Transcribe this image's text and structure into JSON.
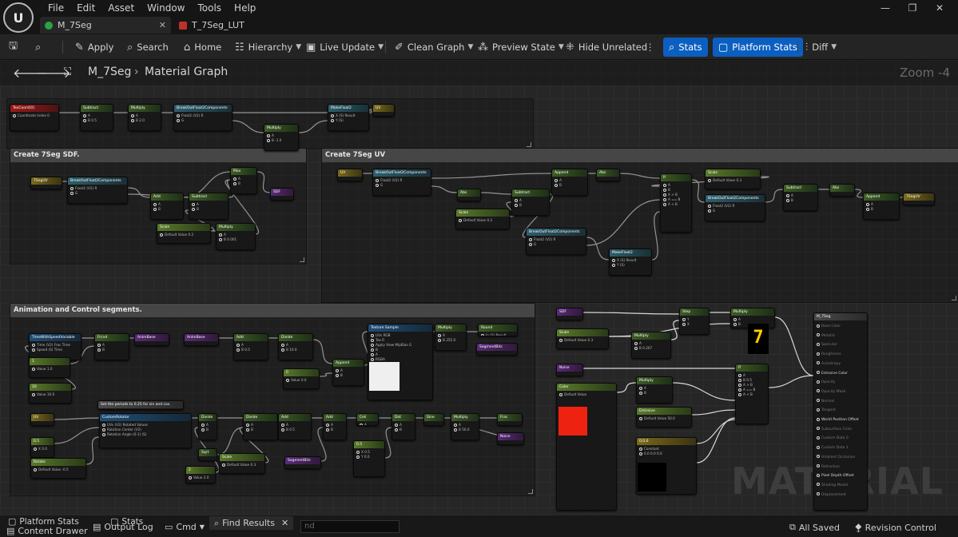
{
  "app": {
    "logo": "U"
  },
  "menu": [
    "File",
    "Edit",
    "Asset",
    "Window",
    "Tools",
    "Help"
  ],
  "window_controls": [
    "—",
    "❐",
    "✕"
  ],
  "tabs": [
    {
      "label": "M_7Seg",
      "active": true,
      "close": "✕",
      "color": "#2aa344"
    },
    {
      "label": "T_7Seg_LUT",
      "active": false,
      "color": "#c0302a"
    }
  ],
  "toolbar": {
    "apply": "Apply",
    "search": "Search",
    "home": "Home",
    "hierarchy": "Hierarchy",
    "live_update": "Live Update",
    "clean_graph": "Clean Graph",
    "preview_state": "Preview State",
    "hide_unrelated": "Hide Unrelated",
    "stats": "Stats",
    "platform_stats": "Platform Stats",
    "diff": "Diff"
  },
  "graph": {
    "breadcrumb": [
      "M_7Seg",
      "Material Graph"
    ],
    "zoom": "Zoom -4",
    "watermark": "MATERIAL"
  },
  "comments": [
    {
      "title": ""
    },
    {
      "title": "Create 7Seg SDF."
    },
    {
      "title": "Create 7Seg UV"
    },
    {
      "title": "Animation and Control segments."
    }
  ],
  "nodes": [
    {
      "title": "TexCoord[0]",
      "color": "red",
      "rows": [
        "Coordinate Index 0"
      ]
    },
    {
      "title": "Subtract",
      "color": "gr",
      "rows": [
        "A",
        "B 0.5"
      ]
    },
    {
      "title": "Multiply",
      "color": "gr",
      "rows": [
        "A",
        "B 2.0"
      ]
    },
    {
      "title": "BreakOutFloat2Components",
      "color": "tl",
      "rows": [
        "Float2 (V2)   R",
        "G"
      ]
    },
    {
      "title": "Multiply",
      "color": "gr",
      "rows": [
        "A",
        "B -1.0"
      ]
    },
    {
      "title": "MakeFloat2",
      "color": "tl",
      "rows": [
        "X (S)  Result",
        "Y (S)"
      ]
    },
    {
      "title": "UV",
      "color": "ol",
      "rows": []
    },
    {
      "title": "7SegUV",
      "color": "ol",
      "rows": []
    },
    {
      "title": "BreakOutFloat2Components",
      "color": "tl",
      "rows": [
        "Float2 (V2)  R",
        "G"
      ]
    },
    {
      "title": "Add",
      "color": "gr",
      "rows": [
        "A",
        "B"
      ]
    },
    {
      "title": "Subtract",
      "color": "gr",
      "rows": [
        "A",
        "B"
      ]
    },
    {
      "title": "Max",
      "color": "gr",
      "rows": [
        "A",
        "B"
      ]
    },
    {
      "title": "SDF",
      "color": "pu",
      "rows": []
    },
    {
      "title": "Scale",
      "color": "gr2",
      "rows": [
        "Default Value 0.2"
      ]
    },
    {
      "title": "Multiply",
      "color": "gr",
      "rows": [
        "A",
        "B 0.001"
      ]
    },
    {
      "title": "UV",
      "color": "ol",
      "rows": []
    },
    {
      "title": "BreakOutFloat2Components",
      "color": "tl",
      "rows": [
        "Float2 (V2)  R",
        "G"
      ]
    },
    {
      "title": "Append",
      "color": "gr",
      "rows": [
        "A",
        "B"
      ]
    },
    {
      "title": "Abs",
      "color": "gr",
      "rows": []
    },
    {
      "title": "Abs",
      "color": "gr",
      "rows": []
    },
    {
      "title": "Subtract",
      "color": "gr",
      "rows": [
        "A",
        "B"
      ]
    },
    {
      "title": "Scale",
      "color": "gr2",
      "rows": [
        "Default Value 0.2"
      ]
    },
    {
      "title": "BreakOutFloat2Components",
      "color": "tl",
      "rows": [
        "Float2 (V2)  R",
        "G"
      ]
    },
    {
      "title": "MakeFloat2",
      "color": "tl",
      "rows": [
        "X (S)  Result",
        "Y (S)"
      ]
    },
    {
      "title": "If",
      "color": "gr",
      "rows": [
        "A",
        "B",
        "A > B",
        "A == B",
        "A < B"
      ]
    },
    {
      "title": "Scale",
      "color": "gr2",
      "rows": [
        "Default Value 0.3"
      ]
    },
    {
      "title": "BreakOutFloat2Components",
      "color": "tl",
      "rows": [
        "Float2 (V2)  R",
        "G"
      ]
    },
    {
      "title": "Subtract",
      "color": "gr",
      "rows": [
        "A",
        "B"
      ]
    },
    {
      "title": "Abs",
      "color": "gr",
      "rows": []
    },
    {
      "title": "Append",
      "color": "gr",
      "rows": [
        "A",
        "B"
      ]
    },
    {
      "title": "7SegUV",
      "color": "ol",
      "rows": []
    },
    {
      "title": "TimeWithSpeedVariable",
      "color": "bl",
      "rows": [
        "Time (V2)  Frac Time",
        "Speed (S)  Time"
      ]
    },
    {
      "title": "1",
      "color": "gr2",
      "rows": [
        "Value 1.0"
      ]
    },
    {
      "title": "10",
      "color": "gr2",
      "rows": [
        "Value 10.0"
      ]
    },
    {
      "title": "Frcnd",
      "color": "gr",
      "rows": [
        "A",
        "B"
      ]
    },
    {
      "title": "AnimBase",
      "color": "pu",
      "rows": []
    },
    {
      "title": "AnimBase",
      "color": "pu",
      "rows": []
    },
    {
      "title": "Add",
      "color": "gr",
      "rows": [
        "A",
        "B 0.5"
      ]
    },
    {
      "title": "Divide",
      "color": "gr",
      "rows": [
        "A",
        "B 10.0"
      ]
    },
    {
      "title": "0",
      "color": "gr2",
      "rows": [
        "Value 0.0"
      ]
    },
    {
      "title": "Append",
      "color": "gr",
      "rows": [
        "A",
        "B"
      ]
    },
    {
      "title": "Texture Sample",
      "color": "bl",
      "rows": [
        "UVs  RGB",
        "Tex  R",
        "Apply View MipBias  G",
        "B",
        "A",
        "RGBA"
      ]
    },
    {
      "title": "Multiply",
      "color": "gr",
      "rows": [
        "A",
        "B 255.0"
      ]
    },
    {
      "title": "Round",
      "color": "gr",
      "rows": [
        "In (S)  Result"
      ]
    },
    {
      "title": "SegmentBits",
      "color": "pu",
      "rows": []
    },
    {
      "title": "Set the periods to 0.25 for sin and cos.",
      "color": "gy",
      "rows": []
    },
    {
      "title": "UV",
      "color": "ol",
      "rows": []
    },
    {
      "title": "0.5",
      "color": "gr2",
      "rows": [
        "X 0.0"
      ]
    },
    {
      "title": "Rotate",
      "color": "gr2",
      "rows": [
        "Default Value -0.5"
      ]
    },
    {
      "title": "CustomRotator",
      "color": "bl",
      "rows": [
        "UVs (V2)  Rotated Values",
        "Rotation Center (V2)",
        "Rotation Angle (0-1) (S)"
      ]
    },
    {
      "title": "Divide",
      "color": "gr",
      "rows": [
        "A",
        "B"
      ]
    },
    {
      "title": "Sqrt",
      "color": "gr",
      "rows": []
    },
    {
      "title": "2",
      "color": "gr2",
      "rows": [
        "Value 2.0"
      ]
    },
    {
      "title": "Scale",
      "color": "gr2",
      "rows": [
        "Default Value 0.3"
      ]
    },
    {
      "title": "Divide",
      "color": "gr",
      "rows": [
        "A",
        "B"
      ]
    },
    {
      "title": "Add",
      "color": "gr",
      "rows": [
        "A",
        "B 0.5"
      ]
    },
    {
      "title": "SegmentBits",
      "color": "pu",
      "rows": []
    },
    {
      "title": "Add",
      "color": "gr",
      "rows": [
        "A",
        "B"
      ]
    },
    {
      "title": "0.5",
      "color": "gr2",
      "rows": [
        "X 0.5",
        "Y 0.0"
      ]
    },
    {
      "title": "Ceil",
      "color": "gr",
      "rows": [
        "A"
      ]
    },
    {
      "title": "Dot",
      "color": "gr",
      "rows": [
        "A",
        "B"
      ]
    },
    {
      "title": "Sine",
      "color": "gr",
      "rows": []
    },
    {
      "title": "Multiply",
      "color": "gr",
      "rows": [
        "A",
        "B 50.0"
      ]
    },
    {
      "title": "Frac",
      "color": "gr",
      "rows": []
    },
    {
      "title": "Noise",
      "color": "pu",
      "rows": []
    },
    {
      "title": "SDF",
      "color": "pu",
      "rows": []
    },
    {
      "title": "Scale",
      "color": "gr2",
      "rows": [
        "Default Value 0.3"
      ]
    },
    {
      "title": "Multiply",
      "color": "gr",
      "rows": [
        "A",
        "B 0.207"
      ]
    },
    {
      "title": "Step",
      "color": "gr",
      "rows": [
        "Y",
        "X"
      ]
    },
    {
      "title": "Multiply",
      "color": "gr",
      "rows": [
        "A",
        "B"
      ]
    },
    {
      "title": "Noise",
      "color": "pu",
      "rows": []
    },
    {
      "title": "Color",
      "color": "gr2",
      "rows": [
        "Default Value"
      ]
    },
    {
      "title": "Multiply",
      "color": "gr",
      "rows": [
        "A",
        "B"
      ]
    },
    {
      "title": "Emissive",
      "color": "gr2",
      "rows": [
        "Default Value 50.0"
      ]
    },
    {
      "title": "If",
      "color": "gr",
      "rows": [
        "A",
        "B 0.5",
        "A > B",
        "A == B",
        "A < B"
      ]
    },
    {
      "title": "0,0,0",
      "color": "ol",
      "rows": [
        "Constant",
        "0.0  0.0  0.0"
      ]
    }
  ],
  "material_node": {
    "title": "M_7Seg",
    "rows": [
      "Base Color",
      "Metallic",
      "Specular",
      "Roughness",
      "Anisotropy",
      "Emissive Color",
      "Opacity",
      "Opacity Mask",
      "Normal",
      "Tangent",
      "World Position Offset",
      "Subsurface Color",
      "Custom Data 0",
      "Custom Data 1",
      "Ambient Occlusion",
      "Refraction",
      "Pixel Depth Offset",
      "Shading Model",
      "Displacement"
    ],
    "active": [
      5,
      10,
      16
    ]
  },
  "preview": {
    "seven_seg_digit": "7",
    "swatch_color": "#ee2211"
  },
  "statusbar": {
    "platform_stats": "Platform Stats",
    "stats": "Stats",
    "content_drawer": "Content Drawer",
    "output_log": "Output Log",
    "cmd": "Cmd",
    "find_results": "Find Results",
    "find_placeholder": "nd",
    "all_saved": "All Saved",
    "revision_control": "Revision Control"
  }
}
